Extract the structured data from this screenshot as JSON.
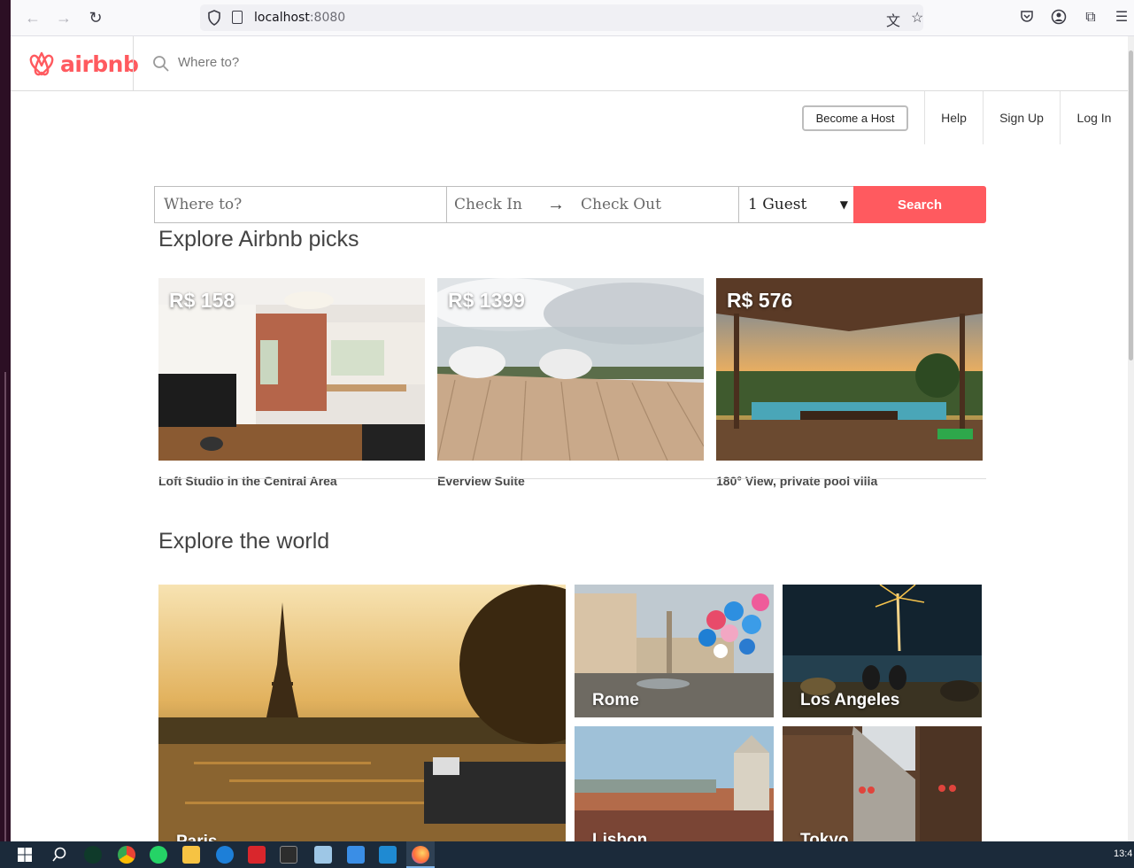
{
  "browser": {
    "url_host": "localhost",
    "url_port": ":8080"
  },
  "site": {
    "logo_text": "airbnb",
    "header_search_placeholder": "Where to?",
    "brand_color": "#ff5a5f"
  },
  "topnav": {
    "become_host": "Become a Host",
    "help": "Help",
    "signup": "Sign Up",
    "login": "Log In"
  },
  "search": {
    "where_placeholder": "Where to?",
    "checkin_placeholder": "Check In",
    "checkout_placeholder": "Check Out",
    "guests": "1 Guest",
    "button": "Search"
  },
  "picks": {
    "title": "Explore Airbnb picks",
    "items": [
      {
        "price": "R$ 158",
        "title": "Loft Studio in the Central Area"
      },
      {
        "price": "R$ 1399",
        "title": "Everview Suite"
      },
      {
        "price": "R$ 576",
        "title": "180° View, private pool villa"
      }
    ]
  },
  "world": {
    "title": "Explore the world",
    "cities": [
      {
        "name": "Paris"
      },
      {
        "name": "Rome"
      },
      {
        "name": "Los Angeles"
      },
      {
        "name": "Lisbon"
      },
      {
        "name": "Tokyo"
      }
    ]
  },
  "taskbar": {
    "clock": "13:4"
  }
}
